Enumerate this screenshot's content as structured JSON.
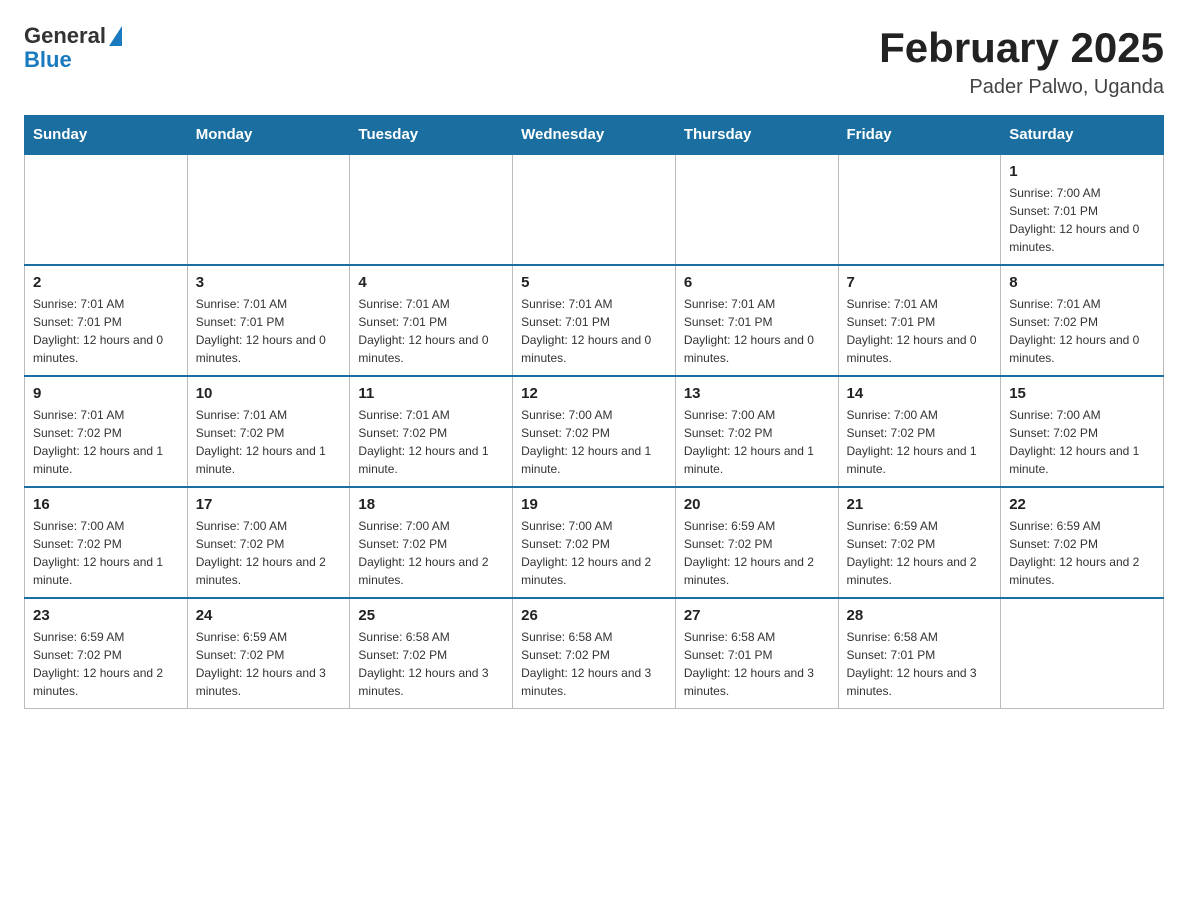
{
  "header": {
    "logo_general": "General",
    "logo_blue": "Blue",
    "month_year": "February 2025",
    "location": "Pader Palwo, Uganda"
  },
  "days_of_week": [
    "Sunday",
    "Monday",
    "Tuesday",
    "Wednesday",
    "Thursday",
    "Friday",
    "Saturday"
  ],
  "weeks": [
    [
      {
        "day": "",
        "info": ""
      },
      {
        "day": "",
        "info": ""
      },
      {
        "day": "",
        "info": ""
      },
      {
        "day": "",
        "info": ""
      },
      {
        "day": "",
        "info": ""
      },
      {
        "day": "",
        "info": ""
      },
      {
        "day": "1",
        "info": "Sunrise: 7:00 AM\nSunset: 7:01 PM\nDaylight: 12 hours and 0 minutes."
      }
    ],
    [
      {
        "day": "2",
        "info": "Sunrise: 7:01 AM\nSunset: 7:01 PM\nDaylight: 12 hours and 0 minutes."
      },
      {
        "day": "3",
        "info": "Sunrise: 7:01 AM\nSunset: 7:01 PM\nDaylight: 12 hours and 0 minutes."
      },
      {
        "day": "4",
        "info": "Sunrise: 7:01 AM\nSunset: 7:01 PM\nDaylight: 12 hours and 0 minutes."
      },
      {
        "day": "5",
        "info": "Sunrise: 7:01 AM\nSunset: 7:01 PM\nDaylight: 12 hours and 0 minutes."
      },
      {
        "day": "6",
        "info": "Sunrise: 7:01 AM\nSunset: 7:01 PM\nDaylight: 12 hours and 0 minutes."
      },
      {
        "day": "7",
        "info": "Sunrise: 7:01 AM\nSunset: 7:01 PM\nDaylight: 12 hours and 0 minutes."
      },
      {
        "day": "8",
        "info": "Sunrise: 7:01 AM\nSunset: 7:02 PM\nDaylight: 12 hours and 0 minutes."
      }
    ],
    [
      {
        "day": "9",
        "info": "Sunrise: 7:01 AM\nSunset: 7:02 PM\nDaylight: 12 hours and 1 minute."
      },
      {
        "day": "10",
        "info": "Sunrise: 7:01 AM\nSunset: 7:02 PM\nDaylight: 12 hours and 1 minute."
      },
      {
        "day": "11",
        "info": "Sunrise: 7:01 AM\nSunset: 7:02 PM\nDaylight: 12 hours and 1 minute."
      },
      {
        "day": "12",
        "info": "Sunrise: 7:00 AM\nSunset: 7:02 PM\nDaylight: 12 hours and 1 minute."
      },
      {
        "day": "13",
        "info": "Sunrise: 7:00 AM\nSunset: 7:02 PM\nDaylight: 12 hours and 1 minute."
      },
      {
        "day": "14",
        "info": "Sunrise: 7:00 AM\nSunset: 7:02 PM\nDaylight: 12 hours and 1 minute."
      },
      {
        "day": "15",
        "info": "Sunrise: 7:00 AM\nSunset: 7:02 PM\nDaylight: 12 hours and 1 minute."
      }
    ],
    [
      {
        "day": "16",
        "info": "Sunrise: 7:00 AM\nSunset: 7:02 PM\nDaylight: 12 hours and 1 minute."
      },
      {
        "day": "17",
        "info": "Sunrise: 7:00 AM\nSunset: 7:02 PM\nDaylight: 12 hours and 2 minutes."
      },
      {
        "day": "18",
        "info": "Sunrise: 7:00 AM\nSunset: 7:02 PM\nDaylight: 12 hours and 2 minutes."
      },
      {
        "day": "19",
        "info": "Sunrise: 7:00 AM\nSunset: 7:02 PM\nDaylight: 12 hours and 2 minutes."
      },
      {
        "day": "20",
        "info": "Sunrise: 6:59 AM\nSunset: 7:02 PM\nDaylight: 12 hours and 2 minutes."
      },
      {
        "day": "21",
        "info": "Sunrise: 6:59 AM\nSunset: 7:02 PM\nDaylight: 12 hours and 2 minutes."
      },
      {
        "day": "22",
        "info": "Sunrise: 6:59 AM\nSunset: 7:02 PM\nDaylight: 12 hours and 2 minutes."
      }
    ],
    [
      {
        "day": "23",
        "info": "Sunrise: 6:59 AM\nSunset: 7:02 PM\nDaylight: 12 hours and 2 minutes."
      },
      {
        "day": "24",
        "info": "Sunrise: 6:59 AM\nSunset: 7:02 PM\nDaylight: 12 hours and 3 minutes."
      },
      {
        "day": "25",
        "info": "Sunrise: 6:58 AM\nSunset: 7:02 PM\nDaylight: 12 hours and 3 minutes."
      },
      {
        "day": "26",
        "info": "Sunrise: 6:58 AM\nSunset: 7:02 PM\nDaylight: 12 hours and 3 minutes."
      },
      {
        "day": "27",
        "info": "Sunrise: 6:58 AM\nSunset: 7:01 PM\nDaylight: 12 hours and 3 minutes."
      },
      {
        "day": "28",
        "info": "Sunrise: 6:58 AM\nSunset: 7:01 PM\nDaylight: 12 hours and 3 minutes."
      },
      {
        "day": "",
        "info": ""
      }
    ]
  ]
}
